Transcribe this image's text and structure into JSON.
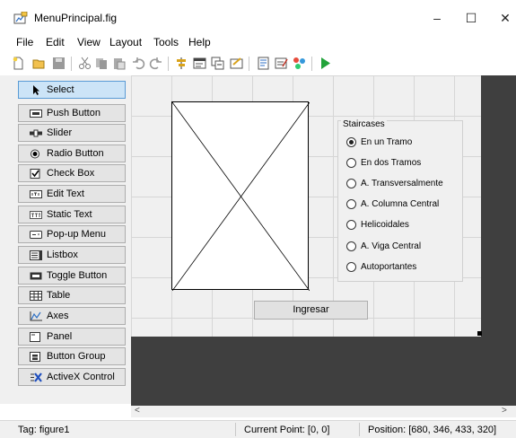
{
  "window": {
    "title": "MenuPrincipal.fig",
    "min_glyph": "–",
    "max_glyph": "☐",
    "close_glyph": "✕"
  },
  "menubar": {
    "items": [
      "File",
      "Edit",
      "View",
      "Layout",
      "Tools",
      "Help"
    ]
  },
  "toolbar": {
    "icons": [
      "new-file-icon",
      "open-folder-icon",
      "save-icon",
      "cut-icon",
      "copy-icon",
      "paste-icon",
      "undo-icon",
      "redo-icon",
      "align-icon",
      "menu-editor-icon",
      "tab-order-icon",
      "toolbar-editor-icon",
      "editor-icon",
      "property-inspector-icon",
      "object-browser-icon",
      "run-icon"
    ]
  },
  "palette": {
    "items": [
      {
        "label": "Select",
        "icon": "select-arrow-icon"
      },
      {
        "label": "Push Button",
        "icon": "push-button-icon"
      },
      {
        "label": "Slider",
        "icon": "slider-icon"
      },
      {
        "label": "Radio Button",
        "icon": "radio-button-icon"
      },
      {
        "label": "Check Box",
        "icon": "check-box-icon"
      },
      {
        "label": "Edit Text",
        "icon": "edit-text-icon"
      },
      {
        "label": "Static Text",
        "icon": "static-text-icon"
      },
      {
        "label": "Pop-up Menu",
        "icon": "popup-menu-icon"
      },
      {
        "label": "Listbox",
        "icon": "listbox-icon"
      },
      {
        "label": "Toggle Button",
        "icon": "toggle-button-icon"
      },
      {
        "label": "Table",
        "icon": "table-icon"
      },
      {
        "label": "Axes",
        "icon": "axes-icon"
      },
      {
        "label": "Panel",
        "icon": "panel-icon"
      },
      {
        "label": "Button Group",
        "icon": "button-group-icon"
      },
      {
        "label": "ActiveX Control",
        "icon": "activex-icon"
      }
    ],
    "selected": "Select"
  },
  "canvas": {
    "button_group": {
      "title": "Staircases",
      "options": [
        "En un Tramo",
        "En dos Tramos",
        "A. Transversalmente",
        "A. Columna Central",
        "Helicoidales",
        "A. Viga Central",
        "Autoportantes"
      ],
      "selected": "En un Tramo"
    },
    "push_button": {
      "label": "Ingresar"
    }
  },
  "scrollbar": {
    "left_glyph": "<",
    "right_glyph": ">"
  },
  "statusbar": {
    "tag": "Tag: figure1",
    "current_point": "Current Point:  [0, 0]",
    "position": "Position: [680, 346, 433, 320]"
  }
}
